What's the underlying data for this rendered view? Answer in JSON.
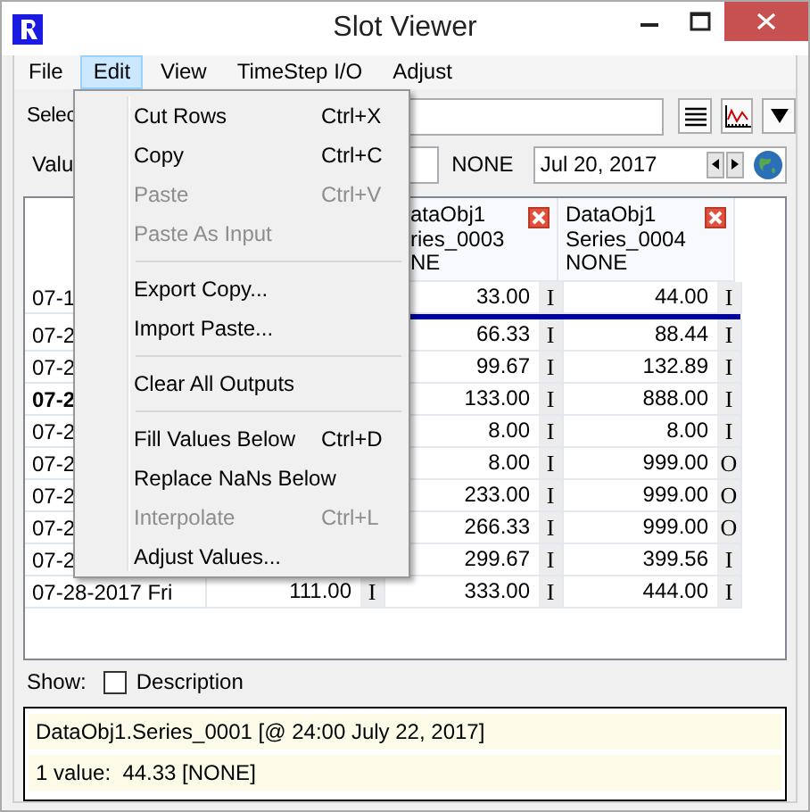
{
  "window": {
    "title": "Slot Viewer"
  },
  "menu_bar": [
    {
      "label": "File",
      "selected": false
    },
    {
      "label": "Edit",
      "selected": true
    },
    {
      "label": "View",
      "selected": false
    },
    {
      "label": "TimeStep I/O",
      "selected": false
    },
    {
      "label": "Adjust",
      "selected": false
    }
  ],
  "edit_menu": {
    "items": [
      {
        "kind": "item",
        "label": "Cut Rows",
        "shortcut": "Ctrl+X",
        "disabled": false
      },
      {
        "kind": "item",
        "label": "Copy",
        "shortcut": "Ctrl+C",
        "disabled": false
      },
      {
        "kind": "item",
        "label": "Paste",
        "shortcut": "Ctrl+V",
        "disabled": true
      },
      {
        "kind": "item",
        "label": "Paste As Input",
        "disabled": true
      },
      {
        "kind": "separator"
      },
      {
        "kind": "item",
        "label": "Export Copy...",
        "disabled": false
      },
      {
        "kind": "item",
        "label": "Import Paste...",
        "disabled": false
      },
      {
        "kind": "separator"
      },
      {
        "kind": "item",
        "label": "Clear All Outputs",
        "disabled": false
      },
      {
        "kind": "separator"
      },
      {
        "kind": "item",
        "label": "Fill Values Below",
        "shortcut": "Ctrl+D",
        "disabled": false
      },
      {
        "kind": "item",
        "label": "Replace NaNs Below",
        "disabled": false
      },
      {
        "kind": "item",
        "label": "Interpolate",
        "shortcut": "Ctrl+L",
        "disabled": true
      },
      {
        "kind": "item",
        "label": "Adjust Values...",
        "disabled": false
      }
    ]
  },
  "controls": {
    "select_label": "Selec",
    "value_label": "Valu",
    "units": "NONE",
    "date": "Jul 20, 2017"
  },
  "table": {
    "columns": [
      null,
      {
        "header": [
          "ataObj1",
          "ries_0003",
          "NE"
        ],
        "closable": true
      },
      {
        "header": [
          "DataObj1",
          "Series_0004",
          "NONE"
        ],
        "closable": true
      }
    ],
    "rows": [
      {
        "date": "07-1",
        "current": false,
        "below_line": true,
        "cells": [
          null,
          {
            "value": "33.00",
            "flag": "I"
          },
          {
            "value": "44.00",
            "flag": "I"
          }
        ]
      },
      {
        "date": "07-2",
        "current": false,
        "below_line": false,
        "cells": [
          null,
          {
            "value": "66.33",
            "flag": "I"
          },
          {
            "value": "88.44",
            "flag": "I"
          }
        ]
      },
      {
        "date": "07-2",
        "current": false,
        "below_line": false,
        "cells": [
          null,
          {
            "value": "99.67",
            "flag": "I"
          },
          {
            "value": "132.89",
            "flag": "I"
          }
        ]
      },
      {
        "date": "07-2",
        "current": true,
        "below_line": false,
        "cells": [
          null,
          {
            "value": "133.00",
            "flag": "I"
          },
          {
            "value": "888.00",
            "flag": "I"
          }
        ]
      },
      {
        "date": "07-2",
        "current": false,
        "below_line": false,
        "cells": [
          null,
          {
            "value": "8.00",
            "flag": "I"
          },
          {
            "value": "8.00",
            "flag": "I"
          }
        ]
      },
      {
        "date": "07-2",
        "current": false,
        "below_line": false,
        "cells": [
          null,
          {
            "value": "8.00",
            "flag": "I"
          },
          {
            "value": "999.00",
            "flag": "O"
          }
        ]
      },
      {
        "date": "07-2",
        "current": false,
        "below_line": false,
        "cells": [
          null,
          {
            "value": "233.00",
            "flag": "I"
          },
          {
            "value": "999.00",
            "flag": "O"
          }
        ]
      },
      {
        "date": "07-2",
        "current": false,
        "below_line": false,
        "cells": [
          null,
          {
            "value": "266.33",
            "flag": "I"
          },
          {
            "value": "999.00",
            "flag": "O"
          }
        ]
      },
      {
        "date": "07-2",
        "current": false,
        "below_line": false,
        "cells": [
          null,
          {
            "value": "299.67",
            "flag": "I"
          },
          {
            "value": "399.56",
            "flag": "I"
          }
        ]
      },
      {
        "date": "07-28-2017 Fri",
        "current": false,
        "below_line": false,
        "cells": [
          {
            "value": "111.00",
            "flag": "I"
          },
          {
            "value": "333.00",
            "flag": "I"
          },
          {
            "value": "444.00",
            "flag": "I"
          }
        ]
      }
    ]
  },
  "show": {
    "label": "Show:",
    "options": [
      {
        "label": "Description",
        "checked": false
      }
    ]
  },
  "info": {
    "lines": [
      "DataObj1.Series_0001 [@ 24:00 July 22, 2017]",
      "1 value:  44.33 [NONE]"
    ]
  }
}
